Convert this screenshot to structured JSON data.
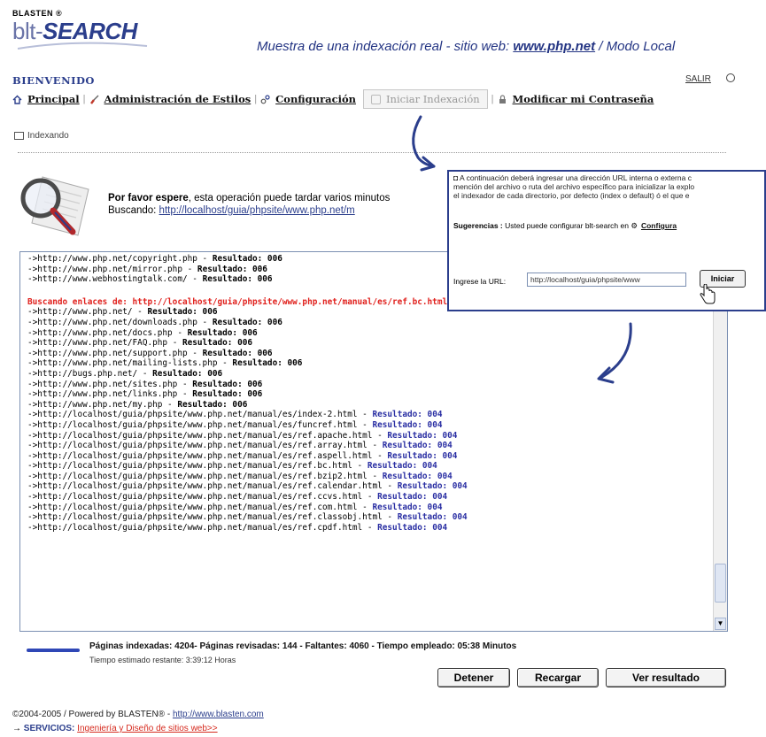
{
  "header": {
    "logo_small": "BLASTEN ®",
    "logo_pre": "blt-",
    "logo_post": "SEARCH",
    "tagline_pre": "Muestra de una indexación real - sitio web: ",
    "tagline_link": "www.php.net",
    "tagline_post": " / Modo Local",
    "welcome": "BIENVENIDO",
    "logout": "SALIR"
  },
  "nav": {
    "principal": "Principal",
    "styles": "Administración de Estilos",
    "config": "Configuración",
    "start_indexing": "Iniciar Indexación",
    "change_password": "Modificar mi Contraseña"
  },
  "status": {
    "section_label": "Indexando",
    "wait_bold": "Por favor espere",
    "wait_rest": ", esta operación puede tardar varios minutos",
    "searching_label": "Buscando: ",
    "searching_url": "http://localhost/guia/phpsite/www.php.net/m"
  },
  "log": {
    "top_lines": [
      {
        "url": "->http://www.php.net/copyright.php",
        "result": "Resultado: 006"
      },
      {
        "url": "->http://www.php.net/mirror.php",
        "result": "Resultado: 006"
      },
      {
        "url": "->http://www.webhostingtalk.com/",
        "result": "Resultado: 006"
      }
    ],
    "heading": "Buscando enlaces de: http://localhost/guia/phpsite/www.php.net/manual/es/ref.bc.html",
    "lines": [
      {
        "url": "->http://www.php.net/",
        "result": "Resultado: 006",
        "kind": "black"
      },
      {
        "url": "->http://www.php.net/downloads.php",
        "result": "Resultado: 006",
        "kind": "black"
      },
      {
        "url": "->http://www.php.net/docs.php",
        "result": "Resultado: 006",
        "kind": "black"
      },
      {
        "url": "->http://www.php.net/FAQ.php",
        "result": "Resultado: 006",
        "kind": "black"
      },
      {
        "url": "->http://www.php.net/support.php",
        "result": "Resultado: 006",
        "kind": "black"
      },
      {
        "url": "->http://www.php.net/mailing-lists.php",
        "result": "Resultado: 006",
        "kind": "black"
      },
      {
        "url": "->http://bugs.php.net/",
        "result": "Resultado: 006",
        "kind": "black"
      },
      {
        "url": "->http://www.php.net/sites.php",
        "result": "Resultado: 006",
        "kind": "black"
      },
      {
        "url": "->http://www.php.net/links.php",
        "result": "Resultado: 006",
        "kind": "black"
      },
      {
        "url": "->http://www.php.net/my.php",
        "result": "Resultado: 006",
        "kind": "black"
      },
      {
        "url": "->http://localhost/guia/phpsite/www.php.net/manual/es/index-2.html",
        "result": "Resultado: 004",
        "kind": "blue"
      },
      {
        "url": "->http://localhost/guia/phpsite/www.php.net/manual/es/funcref.html",
        "result": "Resultado: 004",
        "kind": "blue"
      },
      {
        "url": "->http://localhost/guia/phpsite/www.php.net/manual/es/ref.apache.html",
        "result": "Resultado: 004",
        "kind": "blue"
      },
      {
        "url": "->http://localhost/guia/phpsite/www.php.net/manual/es/ref.array.html",
        "result": "Resultado: 004",
        "kind": "blue"
      },
      {
        "url": "->http://localhost/guia/phpsite/www.php.net/manual/es/ref.aspell.html",
        "result": "Resultado: 004",
        "kind": "blue"
      },
      {
        "url": "->http://localhost/guia/phpsite/www.php.net/manual/es/ref.bc.html",
        "result": "Resultado: 004",
        "kind": "blue"
      },
      {
        "url": "->http://localhost/guia/phpsite/www.php.net/manual/es/ref.bzip2.html",
        "result": "Resultado: 004",
        "kind": "blue"
      },
      {
        "url": "->http://localhost/guia/phpsite/www.php.net/manual/es/ref.calendar.html",
        "result": "Resultado: 004",
        "kind": "blue"
      },
      {
        "url": "->http://localhost/guia/phpsite/www.php.net/manual/es/ref.ccvs.html",
        "result": "Resultado: 004",
        "kind": "blue"
      },
      {
        "url": "->http://localhost/guia/phpsite/www.php.net/manual/es/ref.com.html",
        "result": "Resultado: 004",
        "kind": "blue"
      },
      {
        "url": "->http://localhost/guia/phpsite/www.php.net/manual/es/ref.classobj.html",
        "result": "Resultado: 004",
        "kind": "blue"
      },
      {
        "url": "->http://localhost/guia/phpsite/www.php.net/manual/es/ref.cpdf.html",
        "result": "Resultado: 004",
        "kind": "blue"
      }
    ]
  },
  "popup": {
    "line1": "A continuación deberá ingresar una dirección URL interna o externa c",
    "line2": "mención del archivo o ruta del archivo específico para inicializar la explo",
    "line3": "el indexador de cada directorio, por defecto (index o default) ó el que e",
    "suggestions_label": "Sugerencias :",
    "suggestions_text": " Usted puede configurar blt-search en ",
    "suggestions_link": "Configura",
    "url_label": "Ingrese la URL:",
    "url_value": "http://localhost/guia/phpsite/www",
    "start_button": "Iniciar"
  },
  "progress": {
    "stats": "Páginas indexadas: 4204- Páginas revisadas: 144 - Faltantes: 4060 - Tiempo empleado: 05:38 Minutos",
    "estimate": "Tiempo estimado restante: 3:39:12 Horas",
    "fraction": 0.03
  },
  "buttons": {
    "stop": "Detener",
    "reload": "Recargar",
    "view": "Ver resultado"
  },
  "footer": {
    "copyright": "©2004-2005 / Powered by BLASTEN® - ",
    "link": "http://www.blasten.com",
    "services_label": "SERVICIOS:",
    "services_link": "Ingeniería y Diseño de sitios web>>"
  },
  "colors": {
    "brand": "#2b3e8c",
    "log_heading": "#e0201c",
    "result_blue": "#2a2fa3"
  }
}
